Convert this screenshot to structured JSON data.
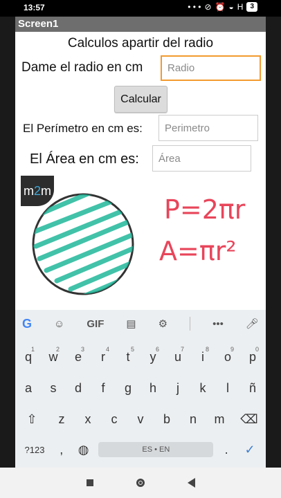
{
  "status_bar": {
    "time": "13:57",
    "signal": "H",
    "battery": "3"
  },
  "app": {
    "title": "Screen1",
    "heading": "Calculos apartir del radio",
    "radius_label": "Dame el radio en cm",
    "radius_placeholder": "Radio",
    "calculate_button": "Calcular",
    "perimeter_label": "El Perímetro en cm es:",
    "perimeter_placeholder": "Perimetro",
    "area_label": "El Área en cm es:",
    "area_placeholder": "Área",
    "logo_text_left": "m",
    "logo_text_mid": "2",
    "logo_text_right": "m",
    "formula_perimeter": "P=2πr",
    "formula_area": "A=πr²",
    "colors": {
      "formula_p": "#e8455a",
      "formula_blue": "#3f7fd4",
      "circle_fill": "#20b89a",
      "focus": "#f29a2e"
    }
  },
  "keyboard": {
    "toolbar": [
      "google-icon",
      "sticker-icon",
      "GIF",
      "clipboard-icon",
      "gear-icon",
      "more-icon",
      "mic-icon"
    ],
    "gif_label": "GIF",
    "more_label": "•••",
    "row1": [
      {
        "k": "q",
        "s": "1"
      },
      {
        "k": "w",
        "s": "2"
      },
      {
        "k": "e",
        "s": "3"
      },
      {
        "k": "r",
        "s": "4"
      },
      {
        "k": "t",
        "s": "5"
      },
      {
        "k": "y",
        "s": "6"
      },
      {
        "k": "u",
        "s": "7"
      },
      {
        "k": "i",
        "s": "8"
      },
      {
        "k": "o",
        "s": "9"
      },
      {
        "k": "p",
        "s": "0"
      }
    ],
    "row2": [
      "a",
      "s",
      "d",
      "f",
      "g",
      "h",
      "j",
      "k",
      "l",
      "ñ"
    ],
    "row3": [
      "z",
      "x",
      "c",
      "v",
      "b",
      "n",
      "m"
    ],
    "symbols_key": "?123",
    "comma_key": ",",
    "space_label": "ES • EN",
    "period_key": "."
  }
}
